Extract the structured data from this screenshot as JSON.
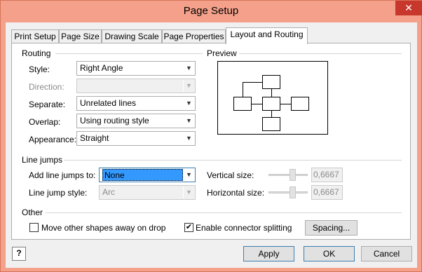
{
  "window": {
    "title": "Page Setup",
    "close_glyph": "✕"
  },
  "tabs": [
    {
      "label": "Print Setup"
    },
    {
      "label": "Page Size"
    },
    {
      "label": "Drawing Scale"
    },
    {
      "label": "Page Properties"
    },
    {
      "label": "Layout and Routing"
    }
  ],
  "routing": {
    "group_label": "Routing",
    "style": {
      "label": "Style:",
      "value": "Right Angle"
    },
    "direction": {
      "label": "Direction:",
      "value": ""
    },
    "separate": {
      "label": "Separate:",
      "value": "Unrelated lines"
    },
    "overlap": {
      "label": "Overlap:",
      "value": "Using routing style"
    },
    "appearance": {
      "label": "Appearance:",
      "value": "Straight"
    }
  },
  "preview": {
    "group_label": "Preview"
  },
  "line_jumps": {
    "group_label": "Line jumps",
    "add_label": "Add line jumps to:",
    "add_value": "None",
    "style_label": "Line jump style:",
    "style_value": "Arc",
    "vertical_label": "Vertical size:",
    "vertical_value": "0,6667",
    "horizontal_label": "Horizontal size:",
    "horizontal_value": "0,6667"
  },
  "other": {
    "group_label": "Other",
    "move_shapes": {
      "label": "Move other shapes away on drop",
      "checked": false
    },
    "enable_split": {
      "label": "Enable connector splitting",
      "checked": true,
      "check_glyph": "✔"
    },
    "spacing_button": "Spacing..."
  },
  "footer": {
    "help_glyph": "?",
    "apply": "Apply",
    "ok": "OK",
    "cancel": "Cancel"
  },
  "icons": {
    "dropdown": "▼"
  }
}
